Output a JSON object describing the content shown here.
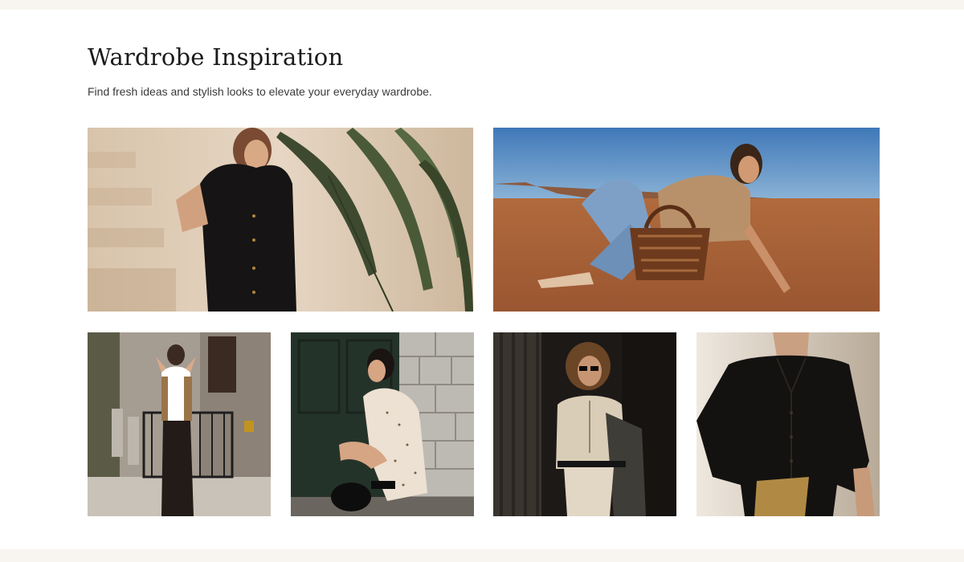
{
  "section": {
    "title": "Wardrobe Inspiration",
    "subtitle": "Find fresh ideas and stylish looks to elevate your everyday wardrobe."
  },
  "colors": {
    "background": "#ffffff",
    "strip": "#f8f5f1",
    "title_text": "#1b1b1b",
    "body_text": "#3a3a3a"
  },
  "gallery": [
    {
      "subject": "black-knit-dress"
    },
    {
      "subject": "desert-denim-look"
    },
    {
      "subject": "city-vest-look"
    },
    {
      "subject": "polka-dot-dress"
    },
    {
      "subject": "cardigan-sunglasses-look"
    },
    {
      "subject": "black-blouse"
    }
  ]
}
